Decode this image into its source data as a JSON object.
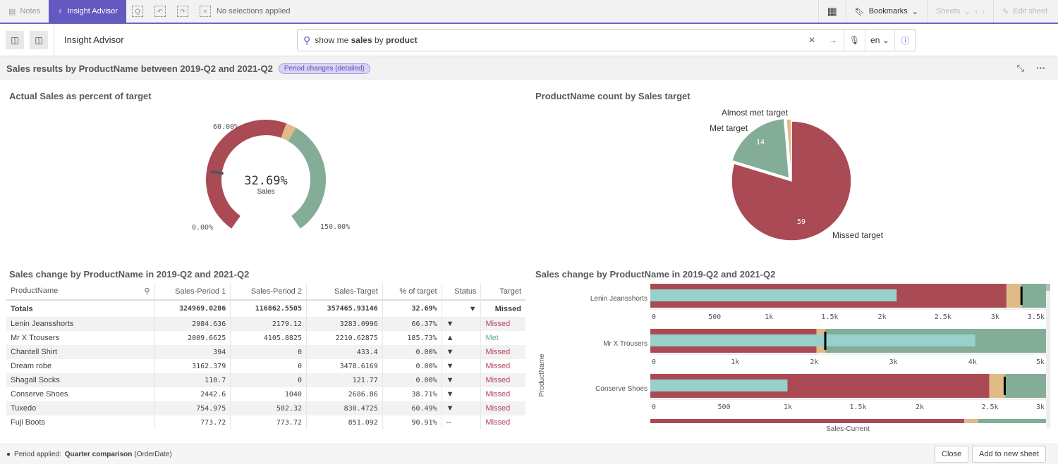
{
  "topbar": {
    "notes": "Notes",
    "insight": "Insight Advisor",
    "selections": "No selections applied",
    "bookmarks": "Bookmarks",
    "sheets": "Sheets",
    "edit": "Edit sheet"
  },
  "toolbar": {
    "title": "Insight Advisor",
    "query_pre": "show me ",
    "query_b1": "sales",
    "query_mid": " by ",
    "query_b2": "product",
    "lang": "en"
  },
  "subheader": {
    "title": "Sales results by ProductName between 2019-Q2 and 2021-Q2",
    "badge": "Period changes (detailed)"
  },
  "gauge": {
    "title": "Actual Sales as percent of target",
    "value": "32.69%",
    "label": "Sales",
    "min": "0.00%",
    "max": "150.00%",
    "target_label": "60.00%",
    "value_num": 32.69,
    "colors": {
      "missed": "#aa4a55",
      "almost": "#e0bb88",
      "met": "#83ad97"
    }
  },
  "pie": {
    "title": "ProductName count by Sales target",
    "chart_data": {
      "type": "pie",
      "slices": [
        {
          "label": "Missed target",
          "value": 59
        },
        {
          "label": "Met target",
          "value": 14
        },
        {
          "label": "Almost met target",
          "value": 1
        }
      ]
    },
    "labels": {
      "missed": "Missed target",
      "met": "Met target",
      "almost": "Almost met target",
      "v_missed": "59",
      "v_met": "14"
    }
  },
  "table": {
    "title": "Sales change by ProductName in 2019-Q2 and 2021-Q2",
    "headers": [
      "ProductName",
      "Sales-Period 1",
      "Sales-Period 2",
      "Sales-Target",
      "% of target",
      "Status",
      "Target"
    ],
    "totals": [
      "Totals",
      "324969.0286",
      "116862.5505",
      "357465.93146",
      "32.69%",
      "▼",
      "Missed"
    ],
    "rows": [
      [
        "Lenin Jeansshorts",
        "2984.636",
        "2179.12",
        "3283.0996",
        "66.37%",
        "▼",
        "Missed"
      ],
      [
        "Mr X Trousers",
        "2009.6625",
        "4105.8825",
        "2210.62875",
        "185.73%",
        "▲",
        "Met"
      ],
      [
        "Chantell Shirt",
        "394",
        "0",
        "433.4",
        "0.00%",
        "▼",
        "Missed"
      ],
      [
        "Dream robe",
        "3162.379",
        "0",
        "3478.6169",
        "0.00%",
        "▼",
        "Missed"
      ],
      [
        "Shagall Socks",
        "110.7",
        "0",
        "121.77",
        "0.00%",
        "▼",
        "Missed"
      ],
      [
        "Conserve Shoes",
        "2442.6",
        "1040",
        "2686.86",
        "38.71%",
        "▼",
        "Missed"
      ],
      [
        "Tuxedo",
        "754.975",
        "502.32",
        "830.4725",
        "60.49%",
        "▼",
        "Missed"
      ],
      [
        "Fuji Boots",
        "773.72",
        "773.72",
        "851.092",
        "90.91%",
        "--",
        "Missed"
      ]
    ]
  },
  "bullet": {
    "title": "Sales change by ProductName in 2019-Q2 and 2021-Q2",
    "ylabel": "ProductName",
    "xlabel": "Sales-Current",
    "chart_data": {
      "type": "bullet",
      "rows": [
        {
          "name": "Lenin Jeansshorts",
          "current": 2179.12,
          "missed_to": 3150,
          "target": 3283.0996,
          "max": 3500,
          "ticks": [
            "0",
            "500",
            "1k",
            "1.5k",
            "2k",
            "2.5k",
            "3k",
            "3.5k"
          ]
        },
        {
          "name": "Mr X Trousers",
          "current": 4105.8825,
          "missed_to": 2100,
          "target": 2210.62875,
          "max": 5000,
          "ticks": [
            "0",
            "1k",
            "2k",
            "3k",
            "4k",
            "5k"
          ]
        },
        {
          "name": "Conserve Shoes",
          "current": 1040,
          "missed_to": 2570,
          "target": 2686.86,
          "max": 3000,
          "ticks": [
            "0",
            "500",
            "1k",
            "1.5k",
            "2k",
            "2.5k",
            "3k"
          ]
        }
      ]
    }
  },
  "footer": {
    "label": "Period applied:",
    "value": "Quarter comparison",
    "suffix": "(OrderDate)",
    "close": "Close",
    "add": "Add to new sheet"
  }
}
